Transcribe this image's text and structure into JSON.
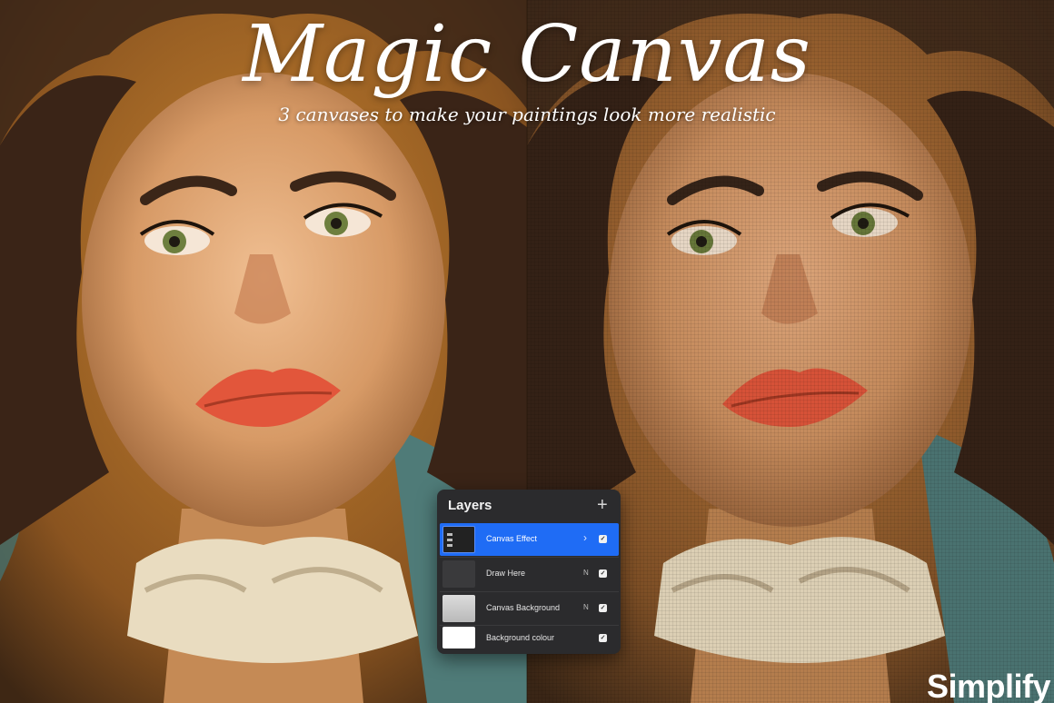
{
  "header": {
    "title": "Magic Canvas",
    "subtitle": "3 canvases to make your paintings look more realistic"
  },
  "layers_panel": {
    "title": "Layers",
    "add_icon": "plus-icon",
    "layers": [
      {
        "name": "Canvas Effect",
        "mode": "",
        "selected": true,
        "visible": true,
        "thumbnail": "canvas-effect-thumbnail"
      },
      {
        "name": "Draw Here",
        "mode": "N",
        "selected": false,
        "visible": true,
        "thumbnail": "dark-gray-thumbnail"
      },
      {
        "name": "Canvas Background",
        "mode": "N",
        "selected": false,
        "visible": true,
        "thumbnail": "light-gray-thumbnail"
      },
      {
        "name": "Background colour",
        "mode": "",
        "selected": false,
        "visible": true,
        "thumbnail": "white-thumbnail"
      }
    ],
    "selection_color": "#1f6cf5",
    "panel_color": "#2b2b2d"
  },
  "brand": {
    "name": "Simplify"
  },
  "colors": {
    "skin": "#c98d5e",
    "lips": "#e2563b",
    "hair": "#3b2618",
    "background": "#b8722a",
    "collar": "#e9dcc0",
    "teal": "#4f7b78"
  }
}
